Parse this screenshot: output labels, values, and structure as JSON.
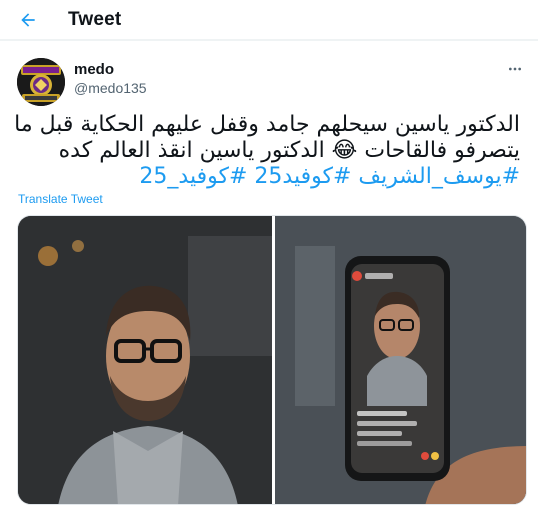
{
  "header": {
    "title": "Tweet",
    "back_icon": "arrow-left-icon"
  },
  "tweet": {
    "author": {
      "name": "medo",
      "handle": "@medo135",
      "avatar_icon": "wrestling-logo-avatar"
    },
    "more_icon": "more-dots-icon",
    "text": {
      "line1": "الدكتور ياسين سيحلهم جامد وقفل عليهم الحكاية قبل ما",
      "line2": "يتصرفو فالقاحات 😂 الدكتور ياسين انقذ العالم كده",
      "hashtags": [
        "#يوسف_الشريف",
        "#كوفيد25",
        "#كوفيد_25"
      ]
    },
    "translate_label": "Translate Tweet",
    "media": [
      {
        "description_icon": "photo-man-glasses"
      },
      {
        "description_icon": "photo-phone-video"
      }
    ]
  },
  "colors": {
    "accent": "#1d9bf0",
    "secondary_text": "#536471",
    "primary_text": "#0f1419"
  }
}
